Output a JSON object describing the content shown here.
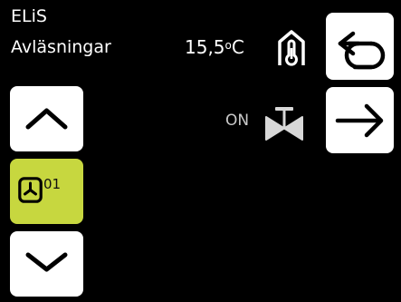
{
  "header": {
    "app_title": "ELiS",
    "page_title": "Avläsningar"
  },
  "temperature": {
    "value": "15,5",
    "degree": "o",
    "unit": "C",
    "icon": "thermometer-house-icon"
  },
  "valve": {
    "state": "ON",
    "icon": "valve-icon"
  },
  "nav": {
    "back_icon": "back-arrow-icon",
    "next_icon": "forward-arrow-icon",
    "up_icon": "chevron-up-icon",
    "down_icon": "chevron-down-icon"
  },
  "fan": {
    "number": "01",
    "icon": "fan-icon"
  },
  "colors": {
    "background": "#000000",
    "button": "#ffffff",
    "selected": "#c7d73f",
    "muted_text": "#c9c9c9"
  }
}
